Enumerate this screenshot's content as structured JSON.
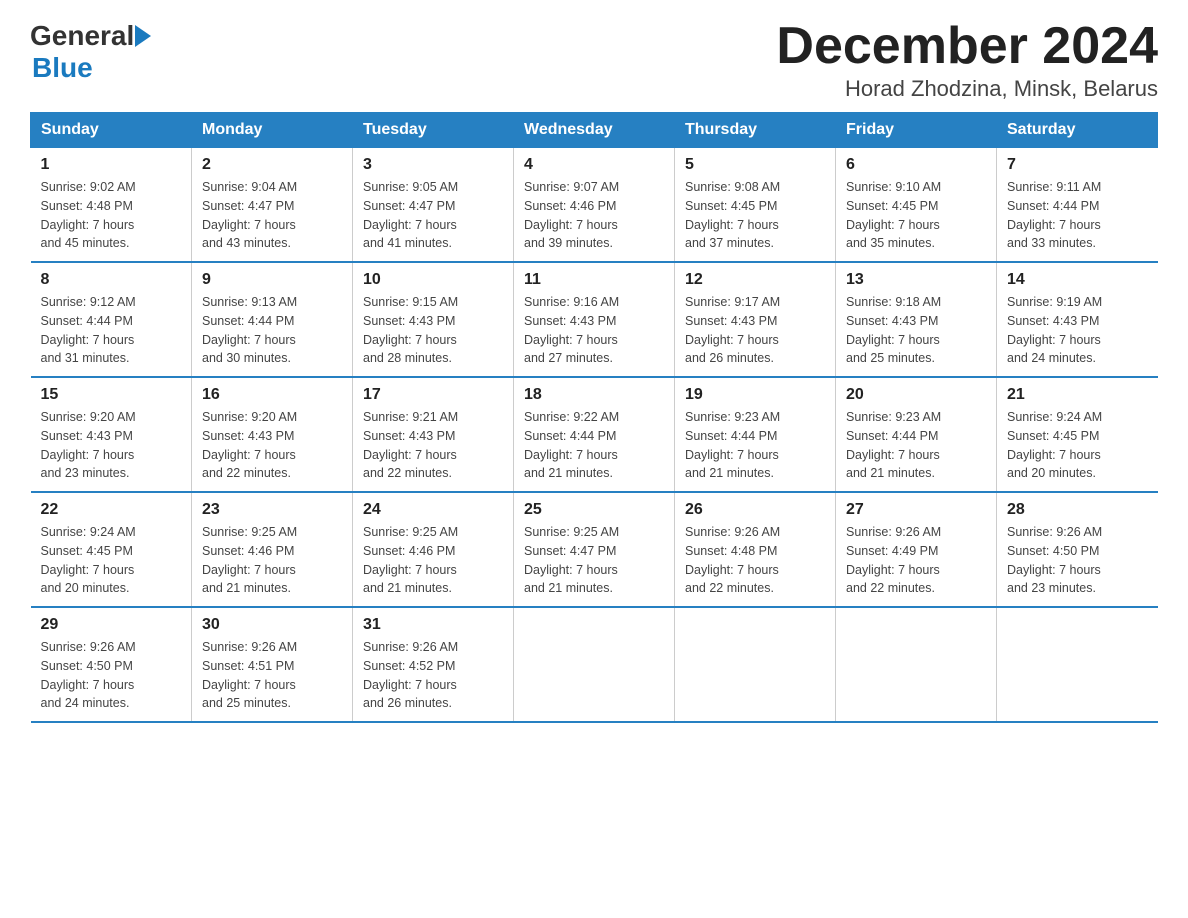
{
  "header": {
    "logo_general": "General",
    "logo_blue": "Blue",
    "month_year": "December 2024",
    "location": "Horad Zhodzina, Minsk, Belarus"
  },
  "days_of_week": [
    "Sunday",
    "Monday",
    "Tuesday",
    "Wednesday",
    "Thursday",
    "Friday",
    "Saturday"
  ],
  "weeks": [
    [
      {
        "day": "1",
        "sunrise": "9:02 AM",
        "sunset": "4:48 PM",
        "daylight": "7 hours and 45 minutes."
      },
      {
        "day": "2",
        "sunrise": "9:04 AM",
        "sunset": "4:47 PM",
        "daylight": "7 hours and 43 minutes."
      },
      {
        "day": "3",
        "sunrise": "9:05 AM",
        "sunset": "4:47 PM",
        "daylight": "7 hours and 41 minutes."
      },
      {
        "day": "4",
        "sunrise": "9:07 AM",
        "sunset": "4:46 PM",
        "daylight": "7 hours and 39 minutes."
      },
      {
        "day": "5",
        "sunrise": "9:08 AM",
        "sunset": "4:45 PM",
        "daylight": "7 hours and 37 minutes."
      },
      {
        "day": "6",
        "sunrise": "9:10 AM",
        "sunset": "4:45 PM",
        "daylight": "7 hours and 35 minutes."
      },
      {
        "day": "7",
        "sunrise": "9:11 AM",
        "sunset": "4:44 PM",
        "daylight": "7 hours and 33 minutes."
      }
    ],
    [
      {
        "day": "8",
        "sunrise": "9:12 AM",
        "sunset": "4:44 PM",
        "daylight": "7 hours and 31 minutes."
      },
      {
        "day": "9",
        "sunrise": "9:13 AM",
        "sunset": "4:44 PM",
        "daylight": "7 hours and 30 minutes."
      },
      {
        "day": "10",
        "sunrise": "9:15 AM",
        "sunset": "4:43 PM",
        "daylight": "7 hours and 28 minutes."
      },
      {
        "day": "11",
        "sunrise": "9:16 AM",
        "sunset": "4:43 PM",
        "daylight": "7 hours and 27 minutes."
      },
      {
        "day": "12",
        "sunrise": "9:17 AM",
        "sunset": "4:43 PM",
        "daylight": "7 hours and 26 minutes."
      },
      {
        "day": "13",
        "sunrise": "9:18 AM",
        "sunset": "4:43 PM",
        "daylight": "7 hours and 25 minutes."
      },
      {
        "day": "14",
        "sunrise": "9:19 AM",
        "sunset": "4:43 PM",
        "daylight": "7 hours and 24 minutes."
      }
    ],
    [
      {
        "day": "15",
        "sunrise": "9:20 AM",
        "sunset": "4:43 PM",
        "daylight": "7 hours and 23 minutes."
      },
      {
        "day": "16",
        "sunrise": "9:20 AM",
        "sunset": "4:43 PM",
        "daylight": "7 hours and 22 minutes."
      },
      {
        "day": "17",
        "sunrise": "9:21 AM",
        "sunset": "4:43 PM",
        "daylight": "7 hours and 22 minutes."
      },
      {
        "day": "18",
        "sunrise": "9:22 AM",
        "sunset": "4:44 PM",
        "daylight": "7 hours and 21 minutes."
      },
      {
        "day": "19",
        "sunrise": "9:23 AM",
        "sunset": "4:44 PM",
        "daylight": "7 hours and 21 minutes."
      },
      {
        "day": "20",
        "sunrise": "9:23 AM",
        "sunset": "4:44 PM",
        "daylight": "7 hours and 21 minutes."
      },
      {
        "day": "21",
        "sunrise": "9:24 AM",
        "sunset": "4:45 PM",
        "daylight": "7 hours and 20 minutes."
      }
    ],
    [
      {
        "day": "22",
        "sunrise": "9:24 AM",
        "sunset": "4:45 PM",
        "daylight": "7 hours and 20 minutes."
      },
      {
        "day": "23",
        "sunrise": "9:25 AM",
        "sunset": "4:46 PM",
        "daylight": "7 hours and 21 minutes."
      },
      {
        "day": "24",
        "sunrise": "9:25 AM",
        "sunset": "4:46 PM",
        "daylight": "7 hours and 21 minutes."
      },
      {
        "day": "25",
        "sunrise": "9:25 AM",
        "sunset": "4:47 PM",
        "daylight": "7 hours and 21 minutes."
      },
      {
        "day": "26",
        "sunrise": "9:26 AM",
        "sunset": "4:48 PM",
        "daylight": "7 hours and 22 minutes."
      },
      {
        "day": "27",
        "sunrise": "9:26 AM",
        "sunset": "4:49 PM",
        "daylight": "7 hours and 22 minutes."
      },
      {
        "day": "28",
        "sunrise": "9:26 AM",
        "sunset": "4:50 PM",
        "daylight": "7 hours and 23 minutes."
      }
    ],
    [
      {
        "day": "29",
        "sunrise": "9:26 AM",
        "sunset": "4:50 PM",
        "daylight": "7 hours and 24 minutes."
      },
      {
        "day": "30",
        "sunrise": "9:26 AM",
        "sunset": "4:51 PM",
        "daylight": "7 hours and 25 minutes."
      },
      {
        "day": "31",
        "sunrise": "9:26 AM",
        "sunset": "4:52 PM",
        "daylight": "7 hours and 26 minutes."
      },
      null,
      null,
      null,
      null
    ]
  ],
  "labels": {
    "sunrise": "Sunrise:",
    "sunset": "Sunset:",
    "daylight": "Daylight:"
  }
}
